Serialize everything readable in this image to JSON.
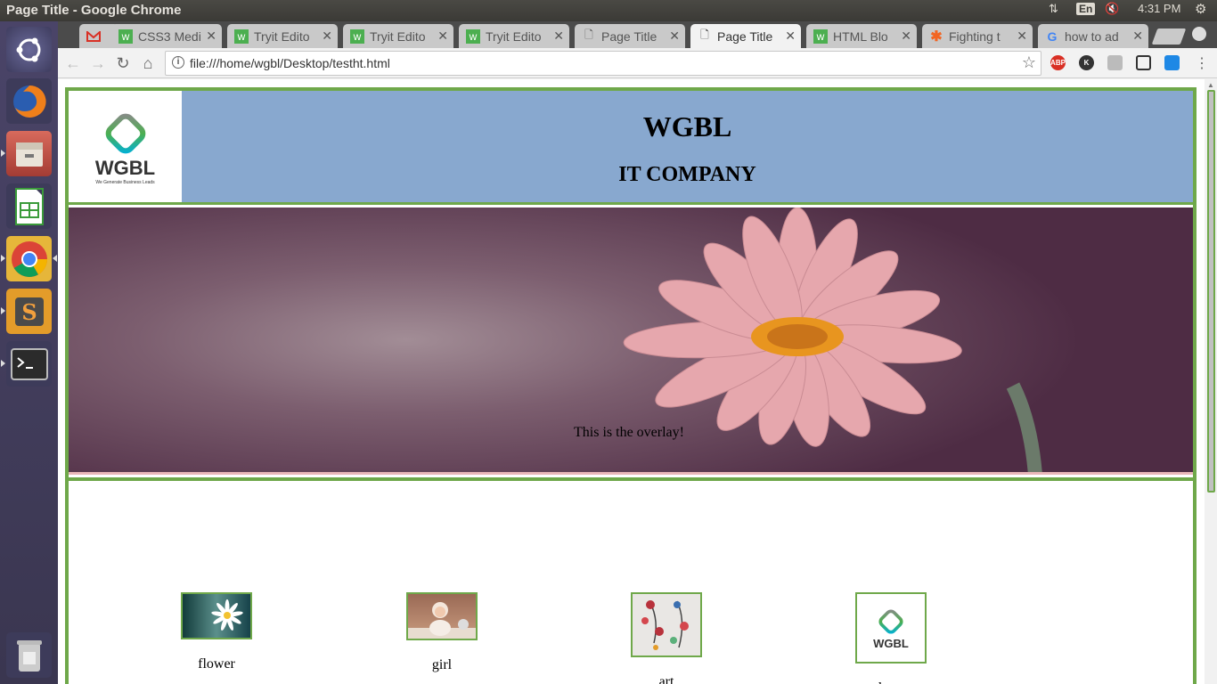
{
  "os": {
    "window_title": "Page Title - Google Chrome",
    "lang": "En",
    "clock": "4:31 PM"
  },
  "tabs": [
    {
      "label": "",
      "icon": "gmail-icon",
      "active": false
    },
    {
      "label": "CSS3 Medi",
      "icon": "w3schools-icon",
      "active": false
    },
    {
      "label": "Tryit Edito",
      "icon": "w3schools-icon",
      "active": false
    },
    {
      "label": "Tryit Edito",
      "icon": "w3schools-icon",
      "active": false
    },
    {
      "label": "Tryit Edito",
      "icon": "w3schools-icon",
      "active": false
    },
    {
      "label": "Page Title",
      "icon": "page-icon",
      "active": false
    },
    {
      "label": "Page Title",
      "icon": "page-icon",
      "active": true
    },
    {
      "label": "HTML Blo",
      "icon": "w3schools-icon",
      "active": false
    },
    {
      "label": "Fighting t",
      "icon": "asterisk-icon",
      "active": false
    },
    {
      "label": "how to ad",
      "icon": "google-icon",
      "active": false
    }
  ],
  "toolbar": {
    "url": "file:///home/wgbl/Desktop/testht.html",
    "extensions": [
      "ABP",
      "K",
      "",
      "",
      ""
    ]
  },
  "page": {
    "logo_text": "WGBL",
    "logo_tagline": "We Generate Business Leads",
    "heading": "WGBL",
    "subheading": "IT COMPANY",
    "overlay_text": "This is the overlay!",
    "gallery": [
      {
        "caption": "flower"
      },
      {
        "caption": "girl"
      },
      {
        "caption": "art"
      },
      {
        "caption": "logo"
      }
    ]
  },
  "colors": {
    "border_green": "#6fa84a",
    "header_blue": "#88a8cf"
  }
}
